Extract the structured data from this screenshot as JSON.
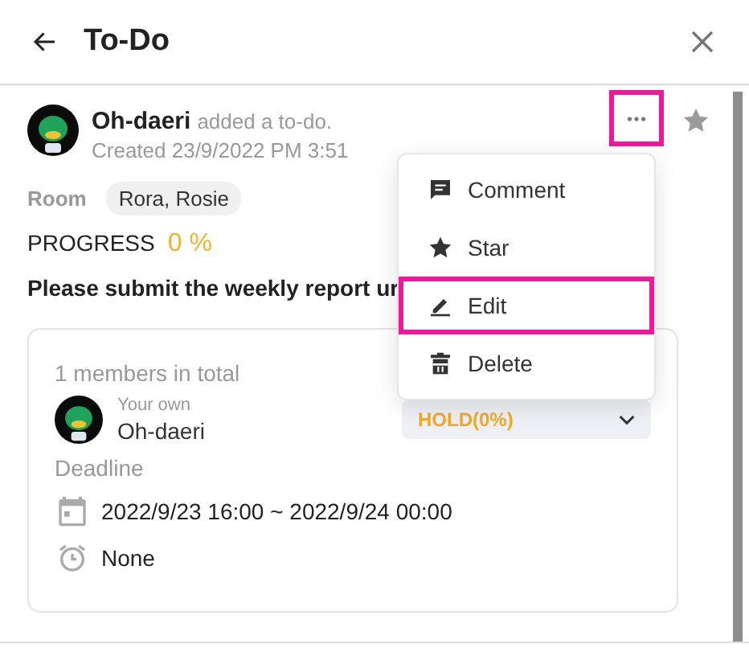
{
  "header": {
    "title": "To-Do"
  },
  "post": {
    "author": "Oh-daeri",
    "action": "added a to-do.",
    "created": "Created 23/9/2022 PM 3:51",
    "more_highlighted": true,
    "starred": false
  },
  "room": {
    "label": "Room",
    "value": "Rora, Rosie"
  },
  "progress": {
    "label": "PROGRESS",
    "value": "0 %"
  },
  "description": "Please submit the weekly report ur",
  "members": {
    "total": "1 members in total",
    "items": [
      {
        "caption": "Your own",
        "name": "Oh-daeri",
        "status": "HOLD(0%)"
      }
    ]
  },
  "deadline": {
    "label": "Deadline",
    "range": "2022/9/23 16:00 ~ 2022/9/24 00:00",
    "reminder": "None"
  },
  "menu": [
    {
      "kind": "comment",
      "label": "Comment",
      "highlighted": false
    },
    {
      "kind": "star",
      "label": "Star",
      "highlighted": false
    },
    {
      "kind": "edit",
      "label": "Edit",
      "highlighted": true
    },
    {
      "kind": "delete",
      "label": "Delete",
      "highlighted": false
    }
  ]
}
